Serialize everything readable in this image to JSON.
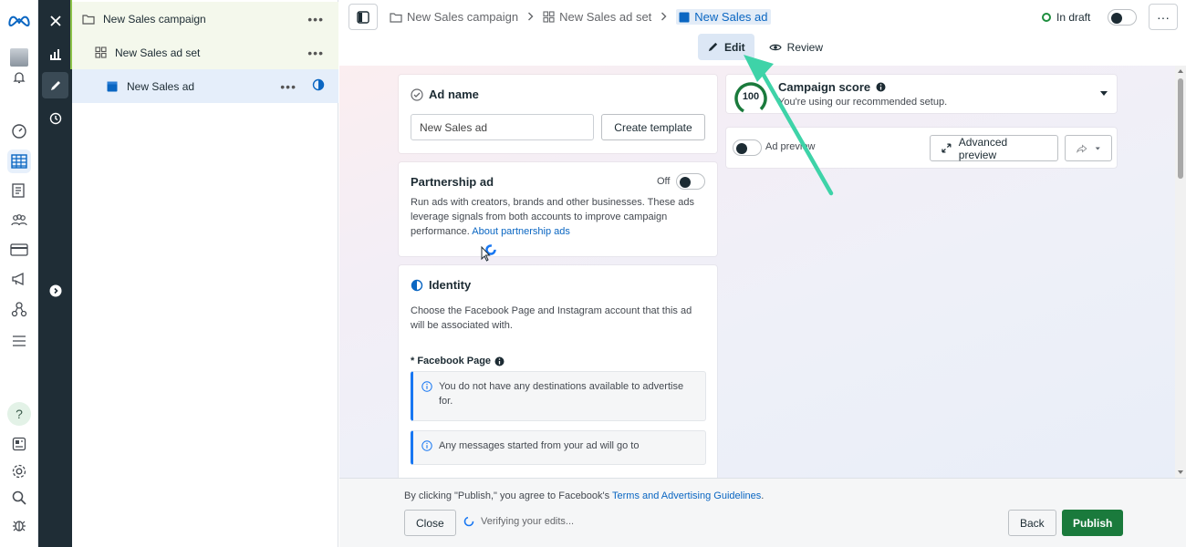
{
  "tree": {
    "campaign": "New Sales campaign",
    "adset": "New Sales ad set",
    "ad": "New Sales ad",
    "more": "•••"
  },
  "breadcrumb": {
    "campaign": "New Sales campaign",
    "adset": "New Sales ad set",
    "ad": "New Sales ad"
  },
  "status": "In draft",
  "more_label": "···",
  "modes": {
    "edit": "Edit",
    "review": "Review"
  },
  "ad_name": {
    "title": "Ad name",
    "value": "New Sales ad",
    "template_button": "Create template"
  },
  "partnership": {
    "title": "Partnership ad",
    "state": "Off",
    "description": "Run ads with creators, brands and other businesses. These ads leverage signals from both accounts to improve campaign performance.",
    "link": "About partnership ads"
  },
  "identity": {
    "title": "Identity",
    "description": "Choose the Facebook Page and Instagram account that this ad will be associated with.",
    "page_label": "* Facebook Page",
    "note1": "You do not have any destinations available to advertise for.",
    "note2": "Any messages started from your ad will go to"
  },
  "score": {
    "value": "100",
    "title": "Campaign score",
    "subtitle": "You're using our recommended setup."
  },
  "preview": {
    "label": "Ad preview",
    "advanced": "Advanced preview"
  },
  "footer": {
    "legal_prefix": "By clicking \"Publish,\" you agree to Facebook's ",
    "legal_link": "Terms and Advertising Guidelines",
    "legal_suffix": ".",
    "close": "Close",
    "verifying": "Verifying your edits...",
    "back": "Back",
    "publish": "Publish"
  },
  "colors": {
    "accent": "#0a66c2",
    "publish": "#1a7a3c",
    "annotation_arrow": "#3ed3a8"
  }
}
